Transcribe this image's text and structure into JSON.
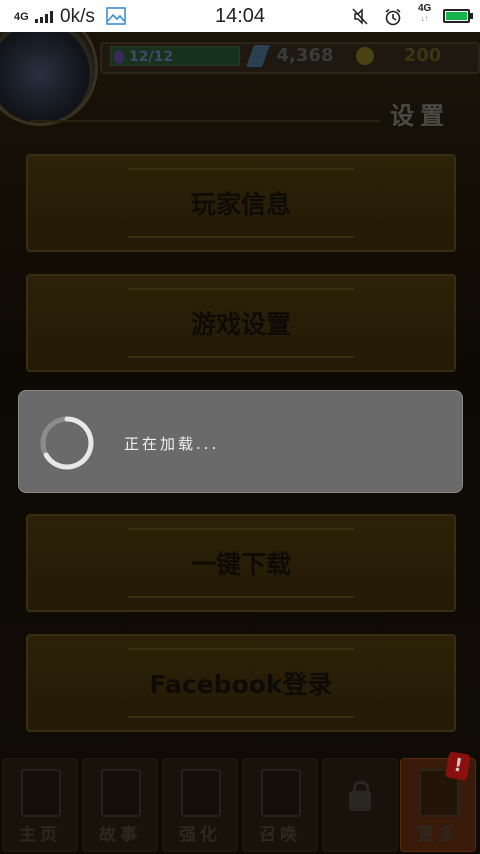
{
  "status_bar": {
    "network_type": "4G",
    "speed": "0k/s",
    "time": "14:04",
    "network_type_2": "4G",
    "battery_percent": 100,
    "icons": [
      "signal-icon",
      "image-notification-icon",
      "mute-icon",
      "alarm-icon",
      "data-arrows-icon",
      "battery-icon"
    ]
  },
  "header": {
    "stamina": "12/12",
    "gems": "4,368",
    "coins": "200",
    "page_title": "设置"
  },
  "menu": {
    "items": [
      {
        "label": "玩家信息"
      },
      {
        "label": "游戏设置"
      },
      {
        "label": "一键下载"
      },
      {
        "label": "Facebook登录"
      }
    ]
  },
  "bottom_nav": {
    "items": [
      {
        "label": "主页",
        "icon": "home-icon"
      },
      {
        "label": "故事",
        "icon": "story-icon"
      },
      {
        "label": "强化",
        "icon": "enhance-icon"
      },
      {
        "label": "召唤",
        "icon": "summon-icon"
      },
      {
        "label": "",
        "icon": "lock-icon"
      },
      {
        "label": "更多",
        "icon": "more-icon",
        "badge": "!"
      }
    ]
  },
  "loading_dialog": {
    "message": "正在加载..."
  },
  "colors": {
    "dialog_bg": "#6a6a6a",
    "battery_green": "#16b34a",
    "alert_badge": "#8a1010"
  }
}
